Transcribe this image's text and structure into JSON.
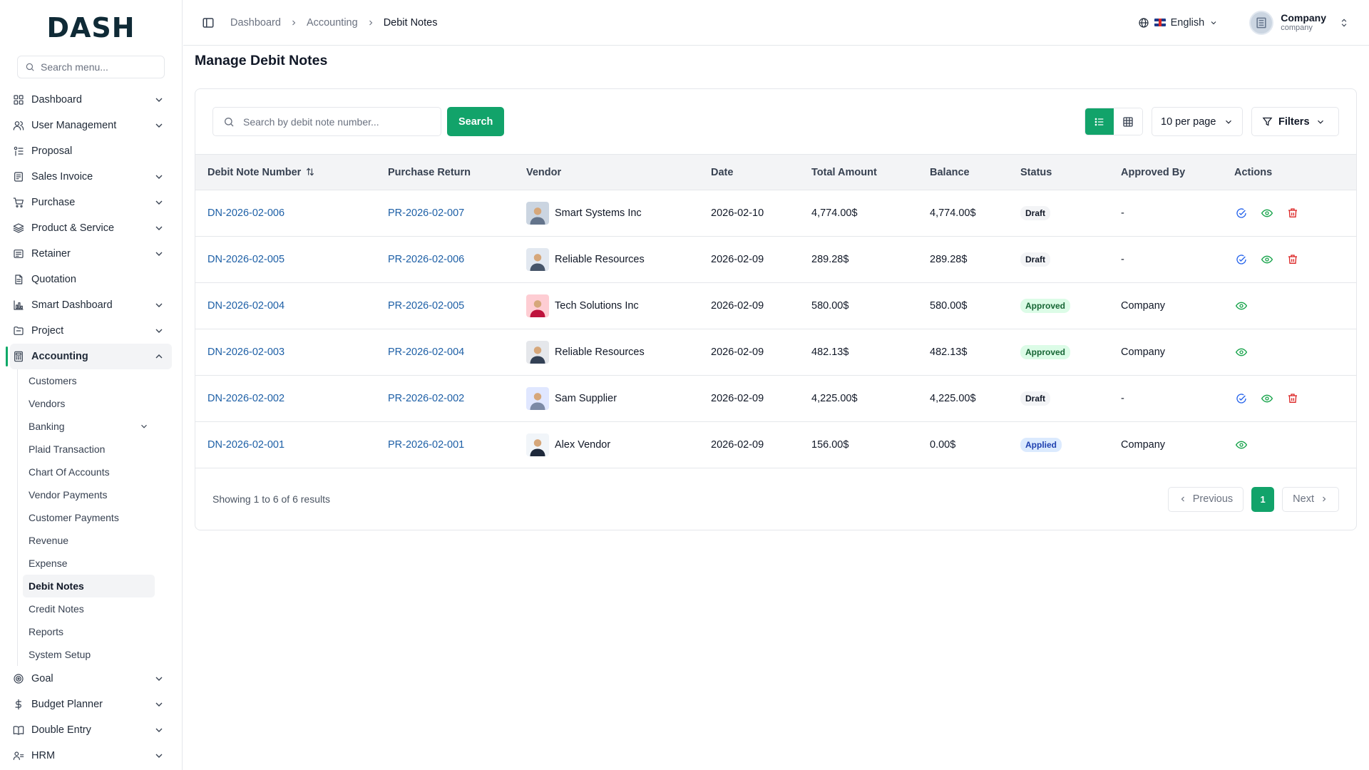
{
  "app": {
    "logo": "DASH"
  },
  "sidebar": {
    "search_placeholder": "Search menu...",
    "items": [
      {
        "label": "Dashboard",
        "icon": "grid-icon",
        "has_chevron": true
      },
      {
        "label": "User Management",
        "icon": "users-icon",
        "has_chevron": true
      },
      {
        "label": "Proposal",
        "icon": "proposal-icon",
        "has_chevron": false
      },
      {
        "label": "Sales Invoice",
        "icon": "invoice-icon",
        "has_chevron": true
      },
      {
        "label": "Purchase",
        "icon": "cart-icon",
        "has_chevron": true
      },
      {
        "label": "Product & Service",
        "icon": "layers-icon",
        "has_chevron": true
      },
      {
        "label": "Retainer",
        "icon": "retainer-icon",
        "has_chevron": true
      },
      {
        "label": "Quotation",
        "icon": "quotation-icon",
        "has_chevron": false
      },
      {
        "label": "Smart Dashboard",
        "icon": "bar-chart-icon",
        "has_chevron": true
      },
      {
        "label": "Project",
        "icon": "folder-icon",
        "has_chevron": true
      },
      {
        "label": "Accounting",
        "icon": "calculator-icon",
        "has_chevron": true,
        "active": true
      }
    ],
    "accounting_sub": [
      {
        "label": "Customers"
      },
      {
        "label": "Vendors"
      },
      {
        "label": "Banking",
        "has_chevron": true
      },
      {
        "label": "Plaid Transaction"
      },
      {
        "label": "Chart Of Accounts"
      },
      {
        "label": "Vendor Payments"
      },
      {
        "label": "Customer Payments"
      },
      {
        "label": "Revenue"
      },
      {
        "label": "Expense"
      },
      {
        "label": "Debit Notes",
        "active": true
      },
      {
        "label": "Credit Notes"
      },
      {
        "label": "Reports"
      },
      {
        "label": "System Setup"
      }
    ],
    "items_after": [
      {
        "label": "Goal",
        "icon": "target-icon",
        "has_chevron": true
      },
      {
        "label": "Budget Planner",
        "icon": "dollar-icon",
        "has_chevron": true
      },
      {
        "label": "Double Entry",
        "icon": "book-icon",
        "has_chevron": true
      },
      {
        "label": "HRM",
        "icon": "hrm-icon",
        "has_chevron": true
      }
    ]
  },
  "header": {
    "breadcrumbs": [
      "Dashboard",
      "Accounting",
      "Debit Notes"
    ],
    "language": "English",
    "company_name": "Company",
    "company_role": "company"
  },
  "page": {
    "title": "Manage Debit Notes",
    "search_placeholder": "Search by debit note number...",
    "search_button": "Search",
    "per_page": "10 per page",
    "filters_label": "Filters"
  },
  "table": {
    "columns": [
      "Debit Note Number",
      "Purchase Return",
      "Vendor",
      "Date",
      "Total Amount",
      "Balance",
      "Status",
      "Approved By",
      "Actions"
    ],
    "rows": [
      {
        "number": "DN-2026-02-006",
        "return": "PR-2026-02-007",
        "vendor": "Smart Systems Inc",
        "date": "2026-02-10",
        "total": "4,774.00$",
        "balance": "4,774.00$",
        "status": "Draft",
        "approved_by": "-"
      },
      {
        "number": "DN-2026-02-005",
        "return": "PR-2026-02-006",
        "vendor": "Reliable Resources",
        "date": "2026-02-09",
        "total": "289.28$",
        "balance": "289.28$",
        "status": "Draft",
        "approved_by": "-"
      },
      {
        "number": "DN-2026-02-004",
        "return": "PR-2026-02-005",
        "vendor": "Tech Solutions Inc",
        "date": "2026-02-09",
        "total": "580.00$",
        "balance": "580.00$",
        "status": "Approved",
        "approved_by": "Company"
      },
      {
        "number": "DN-2026-02-003",
        "return": "PR-2026-02-004",
        "vendor": "Reliable Resources",
        "date": "2026-02-09",
        "total": "482.13$",
        "balance": "482.13$",
        "status": "Approved",
        "approved_by": "Company"
      },
      {
        "number": "DN-2026-02-002",
        "return": "PR-2026-02-002",
        "vendor": "Sam Supplier",
        "date": "2026-02-09",
        "total": "4,225.00$",
        "balance": "4,225.00$",
        "status": "Draft",
        "approved_by": "-"
      },
      {
        "number": "DN-2026-02-001",
        "return": "PR-2026-02-001",
        "vendor": "Alex Vendor",
        "date": "2026-02-09",
        "total": "156.00$",
        "balance": "0.00$",
        "status": "Applied",
        "approved_by": "Company"
      }
    ]
  },
  "pagination": {
    "summary": "Showing 1 to 6 of 6 results",
    "previous": "Previous",
    "current_page": "1",
    "next": "Next"
  },
  "colors": {
    "accent": "#12a36a",
    "link": "#1d5fa6",
    "approve_icon": "#2563eb",
    "view_icon": "#16a34a",
    "delete_icon": "#dc2626"
  }
}
